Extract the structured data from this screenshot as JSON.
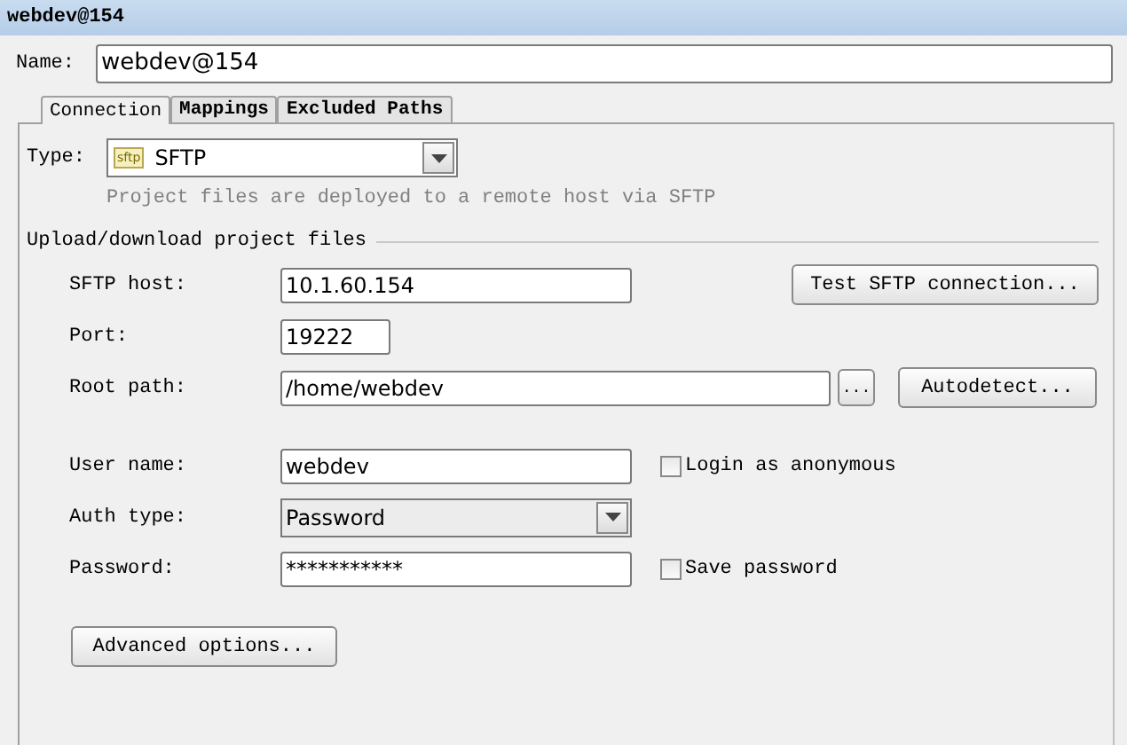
{
  "window": {
    "title": "webdev@154"
  },
  "name_field": {
    "label": "Name:",
    "value": "webdev@154"
  },
  "tabs": [
    {
      "label": "Connection",
      "selected": true
    },
    {
      "label": "Mappings",
      "selected": false
    },
    {
      "label": "Excluded Paths",
      "selected": false
    }
  ],
  "type_field": {
    "label": "Type:",
    "icon_text": "sftp",
    "value": "SFTP",
    "description": "Project files are deployed to a remote host via SFTP"
  },
  "section": {
    "title": "Upload/download project files"
  },
  "rows": [
    {
      "kind": "text",
      "label": "SFTP host:",
      "value": "10.1.60.154",
      "button": {
        "label": "Test SFTP connection..."
      }
    },
    {
      "kind": "text",
      "label": "Port:",
      "value": "19222"
    },
    {
      "kind": "text",
      "label": "Root path:",
      "value": "/home/webdev",
      "browse": "...",
      "button": {
        "label": "Autodetect..."
      }
    },
    {
      "kind": "gap"
    },
    {
      "kind": "text",
      "label": "User name:",
      "value": "webdev",
      "checkbox": {
        "label": "Login as anonymous",
        "checked": false
      }
    },
    {
      "kind": "select",
      "label": "Auth type:",
      "value": "Password"
    },
    {
      "kind": "text",
      "label": "Password:",
      "value": "***********",
      "checkbox": {
        "label": "Save password",
        "checked": false
      }
    }
  ],
  "advanced_button": {
    "label": "Advanced options..."
  }
}
